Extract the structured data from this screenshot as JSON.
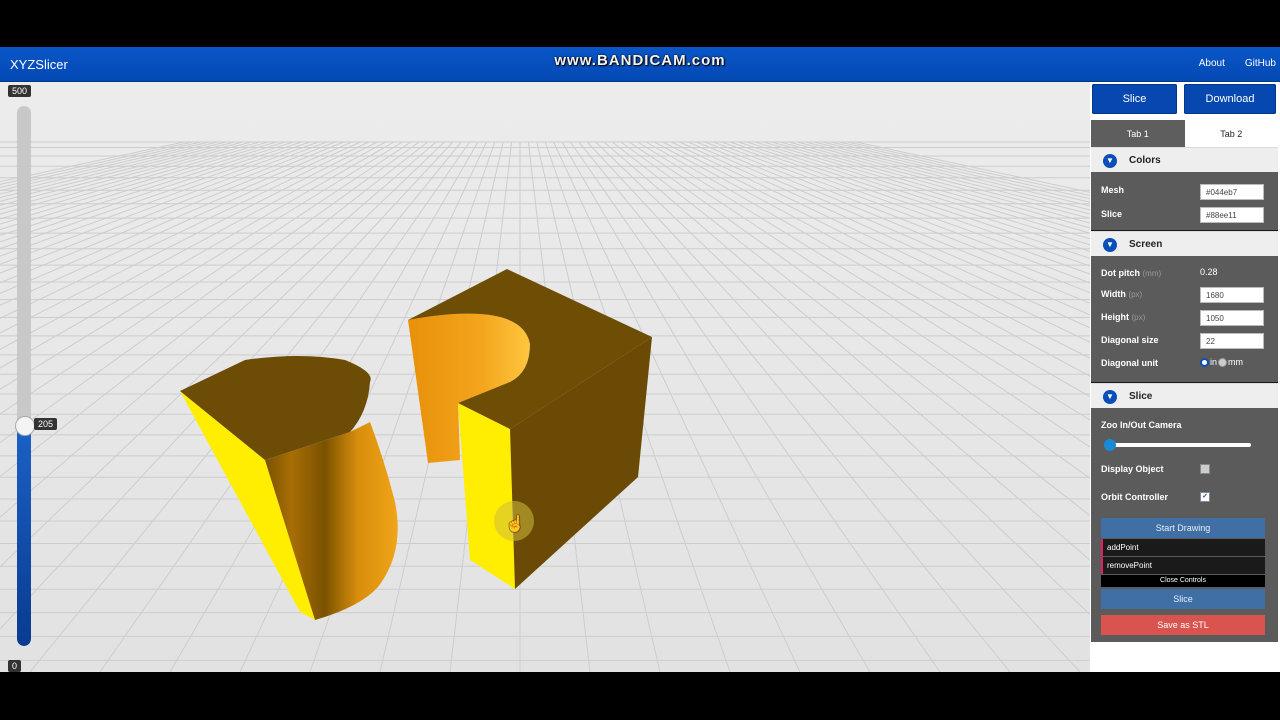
{
  "app": {
    "title": "XYZSlicer",
    "watermark": "www.BANDICAM.com"
  },
  "nav": {
    "about": "About",
    "github": "GitHub"
  },
  "toolbar": {
    "slice": "Slice",
    "download": "Download"
  },
  "tabs": [
    {
      "label": "Tab 1",
      "active": true
    },
    {
      "label": "Tab 2",
      "active": false
    }
  ],
  "layer_slider": {
    "max_label": "500",
    "min_label": "0",
    "current": "205",
    "max": 500,
    "min": 0,
    "value": 205
  },
  "colors_section": {
    "title": "Colors",
    "mesh_label": "Mesh",
    "mesh_value": "#044eb7",
    "slice_label": "Slice",
    "slice_value": "#88ee11"
  },
  "screen_section": {
    "title": "Screen",
    "dot_pitch_label": "Dot pitch",
    "dot_pitch_unit": "(mm)",
    "dot_pitch_value": "0.28",
    "width_label": "Width",
    "width_unit": "(px)",
    "width_value": "1680",
    "height_label": "Height",
    "height_unit": "(px)",
    "height_value": "1050",
    "diag_size_label": "Diagonal size",
    "diag_size_value": "22",
    "diag_unit_label": "Diagonal unit",
    "unit_in": "in",
    "unit_mm": "mm",
    "selected_unit": "in"
  },
  "slice_section": {
    "title": "Slice",
    "zoom_label": "Zoo In/Out Camera",
    "zoom_level": 0.0,
    "display_object_label": "Display Object",
    "display_object_checked": false,
    "orbit_label": "Orbit Controller",
    "orbit_checked": true
  },
  "drawing": {
    "start": "Start Drawing",
    "add_point": "addPoint",
    "remove_point": "removePoint",
    "close_controls": "Close Controls",
    "slice": "Slice",
    "save_stl": "Save as STL"
  },
  "colors": {
    "navbar": "#0648b0",
    "model_top": "#6e4d05",
    "model_side": "#ffea00",
    "model_orange": "#e89a10",
    "save_btn": "#d9534f",
    "gui_btn": "#3f6fa5"
  }
}
